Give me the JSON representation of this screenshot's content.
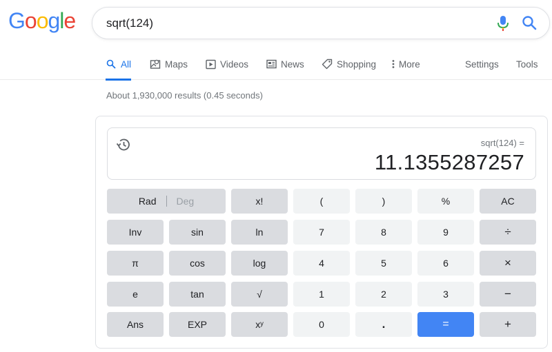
{
  "logo": {
    "letters": [
      {
        "ch": "G",
        "color": "#4285f4"
      },
      {
        "ch": "o",
        "color": "#ea4335"
      },
      {
        "ch": "o",
        "color": "#fbbc05"
      },
      {
        "ch": "g",
        "color": "#4285f4"
      },
      {
        "ch": "l",
        "color": "#34a853"
      },
      {
        "ch": "e",
        "color": "#ea4335"
      }
    ]
  },
  "search": {
    "value": "sqrt(124)"
  },
  "tabs": [
    {
      "label": "All",
      "icon": "search-icon"
    },
    {
      "label": "Maps",
      "icon": "map-icon"
    },
    {
      "label": "Videos",
      "icon": "video-icon"
    },
    {
      "label": "News",
      "icon": "news-icon"
    },
    {
      "label": "Shopping",
      "icon": "tag-icon"
    },
    {
      "label": "More",
      "icon": "more-vert-icon"
    }
  ],
  "tools": {
    "settings_label": "Settings",
    "tools_label": "Tools"
  },
  "stats": "About 1,930,000 results (0.45 seconds)",
  "calculator": {
    "expression": "sqrt(124) =",
    "result": "11.1355287257",
    "rad_label": "Rad",
    "deg_label": "Deg",
    "keys": {
      "fact": "x!",
      "lparen": "(",
      "rparen": ")",
      "percent": "%",
      "ac": "AC",
      "inv": "Inv",
      "sin": "sin",
      "ln": "ln",
      "seven": "7",
      "eight": "8",
      "nine": "9",
      "divide": "÷",
      "pi": "π",
      "cos": "cos",
      "log": "log",
      "four": "4",
      "five": "5",
      "six": "6",
      "multiply": "×",
      "e": "e",
      "tan": "tan",
      "sqrt": "√",
      "one": "1",
      "two": "2",
      "three": "3",
      "minus": "−",
      "ans": "Ans",
      "exp": "EXP",
      "pow": "xʸ",
      "zero": "0",
      "dot": ".",
      "equals": "=",
      "plus": "+"
    }
  },
  "colors": {
    "accent": "#1a73e8",
    "equals_button": "#4285f4",
    "function_key": "#dadce0",
    "number_key": "#f1f3f4"
  }
}
